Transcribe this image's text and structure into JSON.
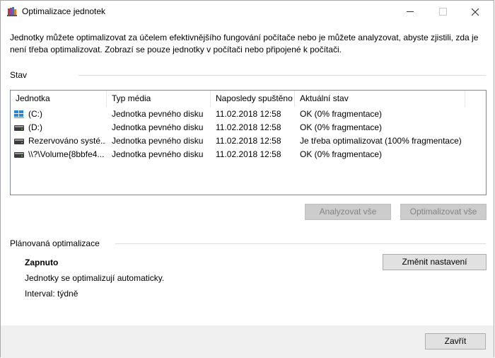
{
  "window": {
    "title": "Optimalizace jednotek"
  },
  "intro": {
    "text": "Jednotky můžete optimalizovat za účelem efektivnějšího fungování počítače nebo je můžete analyzovat, abyste zjistili, zda je není třeba optimalizovat. Zobrazí se pouze jednotky v počítači nebo připojené k počítači."
  },
  "status_section": {
    "label": "Stav",
    "columns": [
      "Jednotka",
      "Typ média",
      "Naposledy spuštěno",
      "Aktuální stav"
    ],
    "rows": [
      {
        "drive": "(C:)",
        "icon": "windows-drive-icon",
        "media": "Jednotka pevného disku",
        "last_run": "11.02.2018 12:58",
        "state": "OK (0% fragmentace)"
      },
      {
        "drive": "(D:)",
        "icon": "drive-icon",
        "media": "Jednotka pevného disku",
        "last_run": "11.02.2018 12:58",
        "state": "OK (0% fragmentace)"
      },
      {
        "drive": "Rezervováno systé...",
        "icon": "drive-icon",
        "media": "Jednotka pevného disku",
        "last_run": "11.02.2018 12:58",
        "state": "Je třeba optimalizovat (100% fragmentace)"
      },
      {
        "drive": "\\\\?\\Volume{8bbfe4...",
        "icon": "drive-icon",
        "media": "Jednotka pevného disku",
        "last_run": "11.02.2018 12:58",
        "state": "OK (0% fragmentace)"
      }
    ],
    "analyze_button": "Analyzovat vše",
    "optimize_button": "Optimalizovat vše"
  },
  "schedule_section": {
    "label": "Plánovaná optimalizace",
    "status": "Zapnuto",
    "description": "Jednotky se optimalizují automaticky.",
    "interval": "Interval: týdně",
    "change_button": "Změnit nastavení"
  },
  "footer": {
    "close_button": "Zavřít"
  }
}
